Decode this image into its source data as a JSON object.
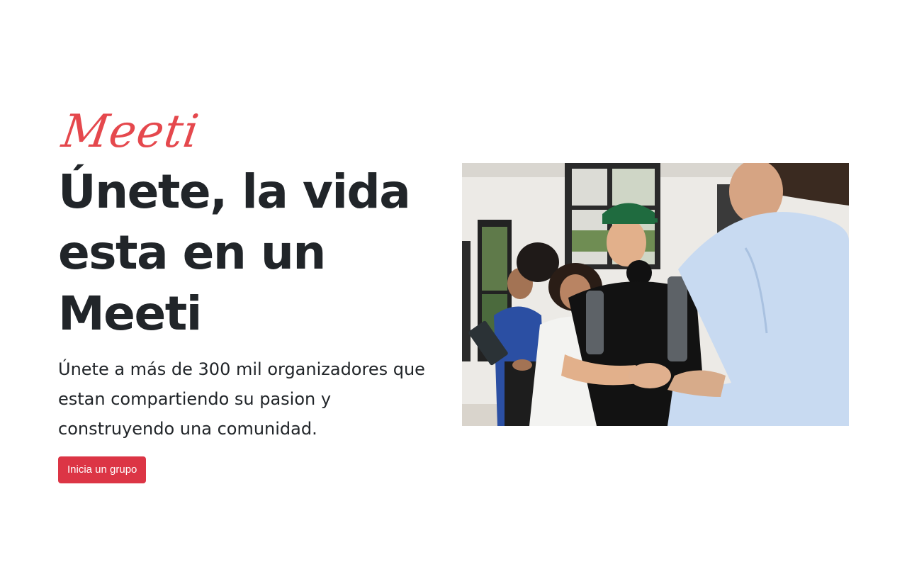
{
  "hero": {
    "logo_text": "Meeti",
    "headline": "Únete, la vida esta en un Meeti",
    "lead": "Únete a más de 300 mil organizadores que estan compartiendo su pasion y construyendo una comunidad.",
    "cta_label": "Inicia un grupo",
    "image_alt": "Grupo de personas sonriendo y saludándose con un apretón de manos"
  },
  "colors": {
    "accent": "#dc3545",
    "logo": "#e5484d",
    "text": "#212529"
  }
}
